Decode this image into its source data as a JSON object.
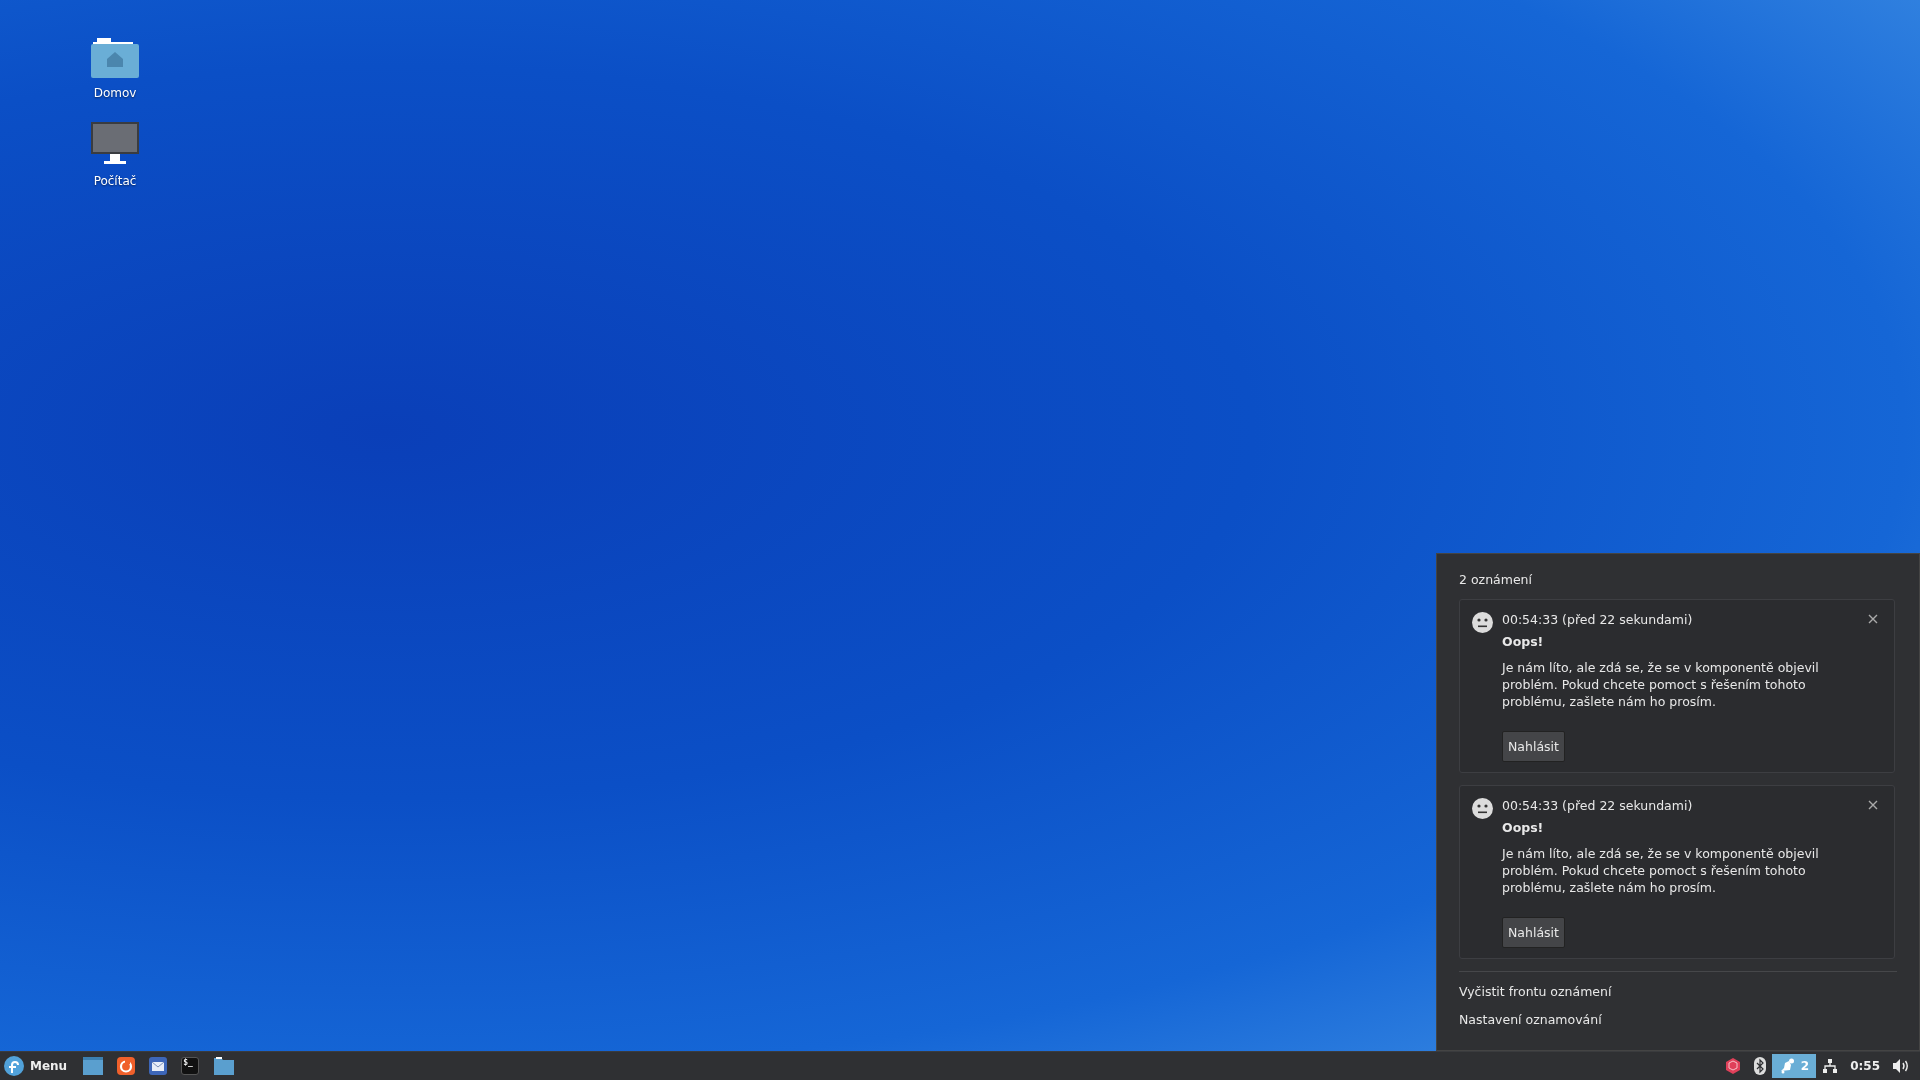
{
  "desktop_icons": [
    {
      "kind": "home-folder",
      "label": "Domov"
    },
    {
      "kind": "computer",
      "label": "Počítač"
    }
  ],
  "notification_panel": {
    "count_label": "2 oznámení",
    "notifications": [
      {
        "time": "00:54:33 (před 22 sekundami)",
        "title": "Oops!",
        "body": "Je nám líto, ale zdá se, že se v komponentě objevil problém. Pokud chcete pomoct s řešením tohoto problému, zašlete nám ho prosím.",
        "action": "Nahlásit"
      },
      {
        "time": "00:54:33 (před 22 sekundami)",
        "title": "Oops!",
        "body": "Je nám líto, ale zdá se, že se v komponentě objevil problém. Pokud chcete pomoct s řešením tohoto problému, zašlete nám ho prosím.",
        "action": "Nahlásit"
      }
    ],
    "links": [
      "Vyčistit frontu oznámení",
      "Nastavení oznamování"
    ]
  },
  "taskbar": {
    "menu_label": "Menu",
    "launchers": [
      {
        "kind": "window"
      },
      {
        "kind": "browser"
      },
      {
        "kind": "mail"
      },
      {
        "kind": "terminal",
        "prompt": "$_"
      },
      {
        "kind": "folder"
      }
    ],
    "tray": [
      {
        "kind": "package"
      },
      {
        "kind": "bluetooth"
      },
      {
        "kind": "notifications",
        "count": "2",
        "active": true
      },
      {
        "kind": "network"
      },
      {
        "kind": "clock",
        "text": "0:55"
      },
      {
        "kind": "volume"
      }
    ]
  }
}
